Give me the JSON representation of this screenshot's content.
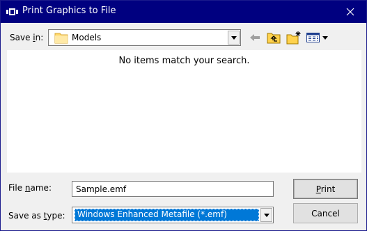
{
  "window": {
    "title": "Print Graphics to File",
    "app_icon": "app-icon",
    "close_icon": "close-icon",
    "title_bar_color": "#000080"
  },
  "toolbar": {
    "save_in_label": "Save in:",
    "save_in_value": "Models",
    "icons": [
      "back-arrow-icon",
      "up-folder-icon",
      "new-folder-icon",
      "view-menu-icon"
    ]
  },
  "file_list": {
    "empty_message": "No items match your search."
  },
  "form": {
    "file_name_label": "File name:",
    "file_name_value": "Sample.emf",
    "save_as_type_label": "Save as type:",
    "save_as_type_value": "Windows Enhanced Metafile (*.emf)",
    "selection_color": "#0078d7"
  },
  "buttons": {
    "print": "Print",
    "cancel": "Cancel"
  }
}
